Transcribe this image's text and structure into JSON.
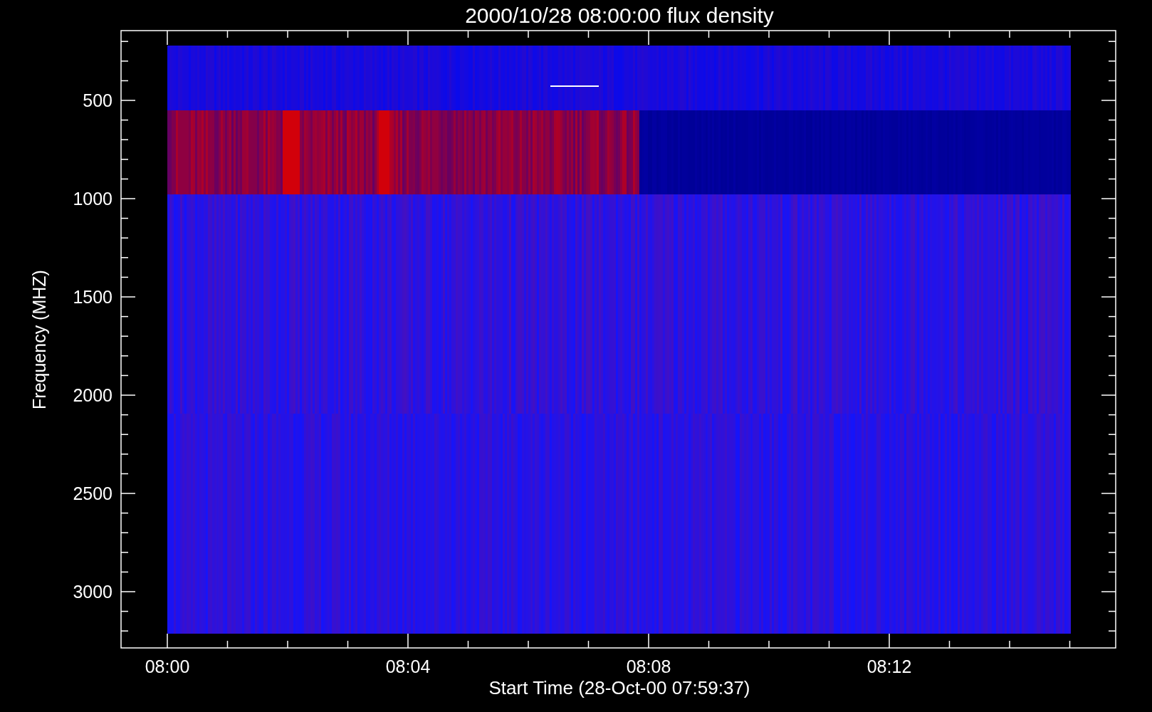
{
  "title": "2000/10/28 08:00:00 flux density",
  "y_axis": {
    "label": "Frequency (MHZ)",
    "ticks": [
      "500",
      "1000",
      "1500",
      "2000",
      "2500",
      "3000"
    ]
  },
  "x_axis": {
    "label": "Start Time (28-Oct-00 07:59:37)",
    "ticks": [
      "08:00",
      "08:04",
      "08:08",
      "08:12"
    ]
  }
}
